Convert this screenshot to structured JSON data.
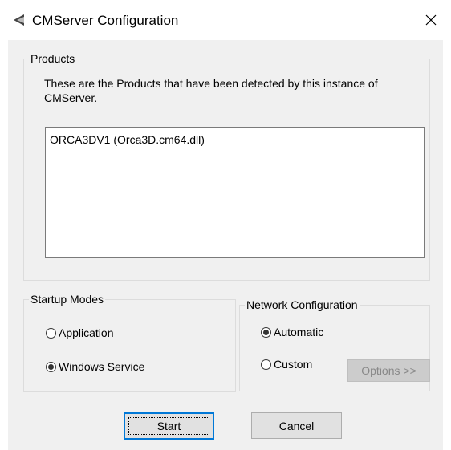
{
  "window": {
    "title": "CMServer Configuration",
    "app_icon": "cmserver-app-icon",
    "close_icon": "close-icon"
  },
  "products": {
    "legend": "Products",
    "description": "These are the Products that have been detected by this instance of CMServer.",
    "items": [
      "ORCA3DV1 (Orca3D.cm64.dll)"
    ]
  },
  "startup_modes": {
    "legend": "Startup Modes",
    "options": [
      {
        "label": "Application",
        "checked": false
      },
      {
        "label": "Windows Service",
        "checked": true
      }
    ]
  },
  "network_configuration": {
    "legend": "Network Configuration",
    "options": [
      {
        "label": "Automatic",
        "checked": true
      },
      {
        "label": "Custom",
        "checked": false
      }
    ],
    "options_button": {
      "label": "Options >>",
      "enabled": false
    }
  },
  "buttons": {
    "start": "Start",
    "cancel": "Cancel"
  },
  "colors": {
    "dialog_background": "#f0f0f0",
    "focus_border": "#0078d7"
  }
}
